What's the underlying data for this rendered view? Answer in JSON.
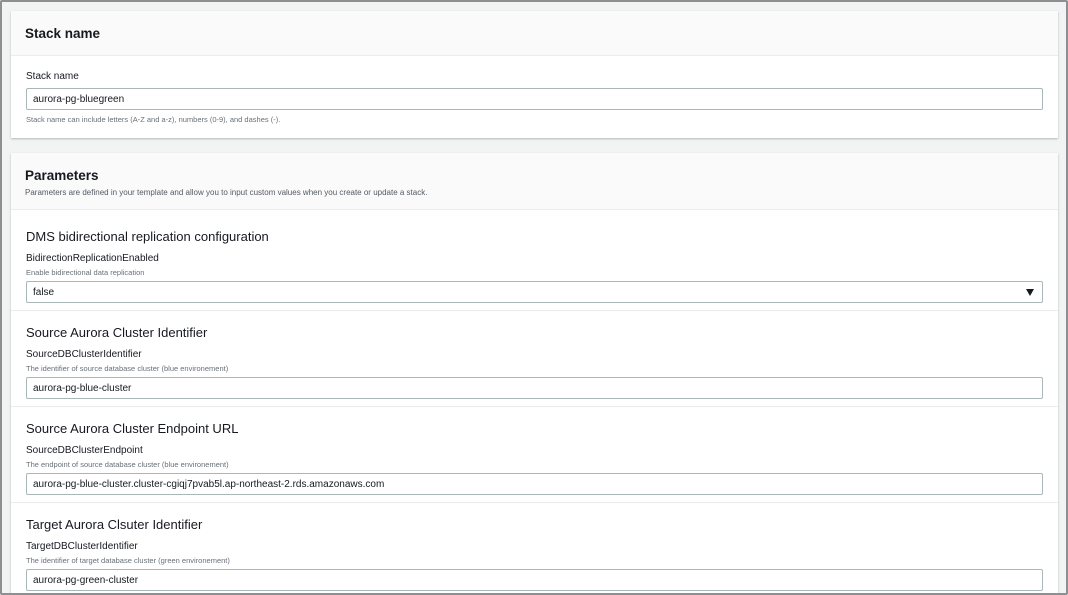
{
  "stack_panel": {
    "title": "Stack name",
    "field_label": "Stack name",
    "value": "aurora-pg-bluegreen",
    "hint": "Stack name can include letters (A-Z and a-z), numbers (0-9), and dashes (-)."
  },
  "params_panel": {
    "title": "Parameters",
    "description": "Parameters are defined in your template and allow you to input custom values when you create or update a stack.",
    "sections": [
      {
        "title": "DMS bidirectional replication configuration",
        "label": "BidirectionReplicationEnabled",
        "description": "Enable bidirectional data replication",
        "value": "false",
        "control": "select"
      },
      {
        "title": "Source Aurora Cluster Identifier",
        "label": "SourceDBClusterIdentifier",
        "description": "The identifier of source database cluster (blue environement)",
        "value": "aurora-pg-blue-cluster",
        "control": "input"
      },
      {
        "title": "Source Aurora Cluster Endpoint URL",
        "label": "SourceDBClusterEndpoint",
        "description": "The endpoint of source database cluster (blue environement)",
        "value": "aurora-pg-blue-cluster.cluster-cgiqj7pvab5l.ap-northeast-2.rds.amazonaws.com",
        "control": "input"
      },
      {
        "title": "Target Aurora Clsuter Identifier",
        "label": "TargetDBClusterIdentifier",
        "description": "The identifier of target database cluster (green environement)",
        "value": "aurora-pg-green-cluster",
        "control": "input"
      }
    ]
  },
  "icons": {
    "select_caret": "caret-down-icon"
  }
}
